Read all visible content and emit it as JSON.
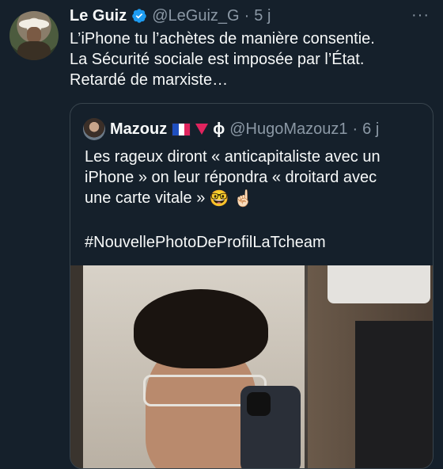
{
  "tweet": {
    "author_name": "Le Guiz",
    "handle": "@LeGuiz_G",
    "separator": "·",
    "time": "5 j",
    "more": "···",
    "lines": [
      "L’iPhone tu l’achètes de manière consentie.",
      "La Sécurité sociale est imposée par l’État.",
      "Retardé de marxiste…"
    ]
  },
  "quote": {
    "author_name": "Mazouz",
    "phi": "ϕ",
    "handle": "@HugoMazouz1",
    "separator": "·",
    "time": "6 j",
    "lines": [
      "Les rageux diront « anticapitaliste avec un",
      "iPhone » on leur répondra « droitard avec",
      "une carte vitale »"
    ],
    "emojis": [
      "🤓",
      "☝🏻"
    ],
    "hashtag": "#NouvellePhotoDeProfilLaTcheam"
  },
  "colors": {
    "background": "#15202b",
    "text": "#f7f9f9",
    "muted": "#8b98a5",
    "verified": "#1d9bf0",
    "border": "#38444d"
  },
  "icons": [
    "verified-badge-icon",
    "more-icon",
    "france-flag-icon",
    "red-triangle-icon"
  ]
}
